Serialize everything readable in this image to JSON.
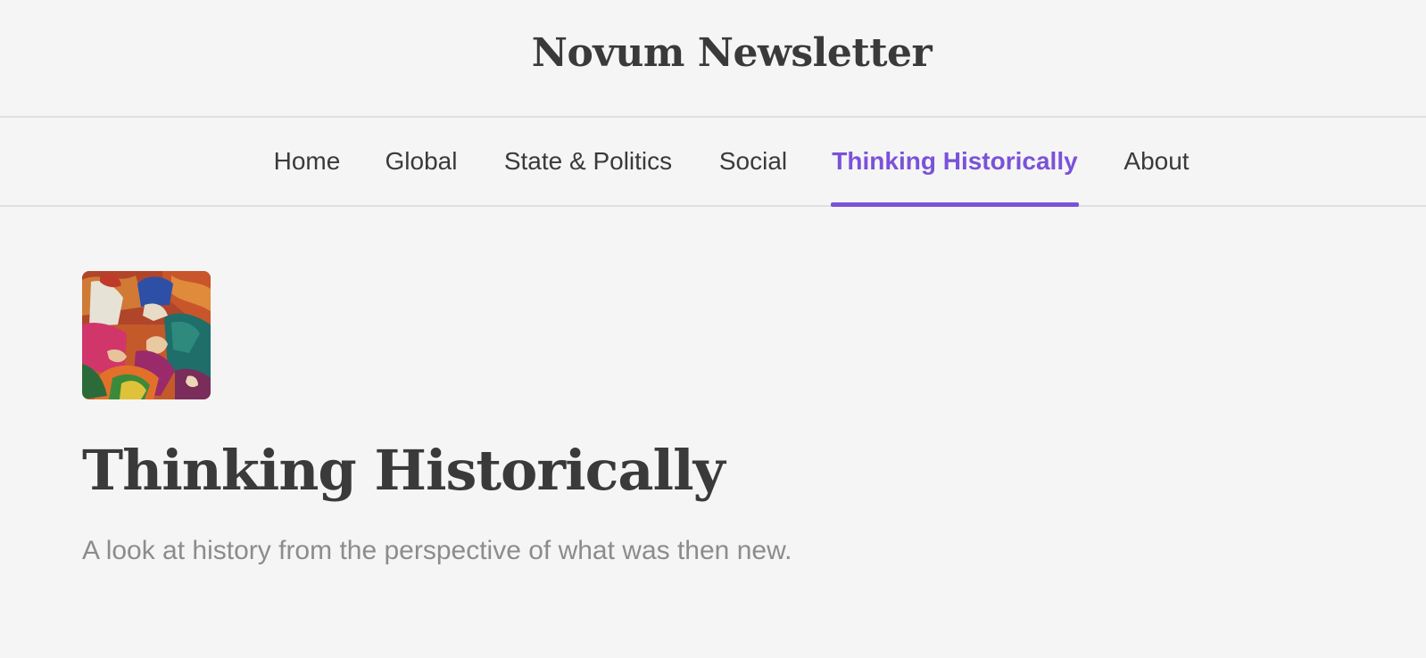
{
  "header": {
    "site_title": "Novum Newsletter"
  },
  "nav": {
    "items": [
      {
        "label": "Home",
        "active": false
      },
      {
        "label": "Global",
        "active": false
      },
      {
        "label": "State & Politics",
        "active": false
      },
      {
        "label": "Social",
        "active": false
      },
      {
        "label": "Thinking Historically",
        "active": true
      },
      {
        "label": "About",
        "active": false
      }
    ],
    "active_color": "#7a52d9"
  },
  "section": {
    "thumbnail_icon": "painting-thumbnail",
    "title": "Thinking Historically",
    "description": "A look at history from the perspective of what was then new."
  }
}
